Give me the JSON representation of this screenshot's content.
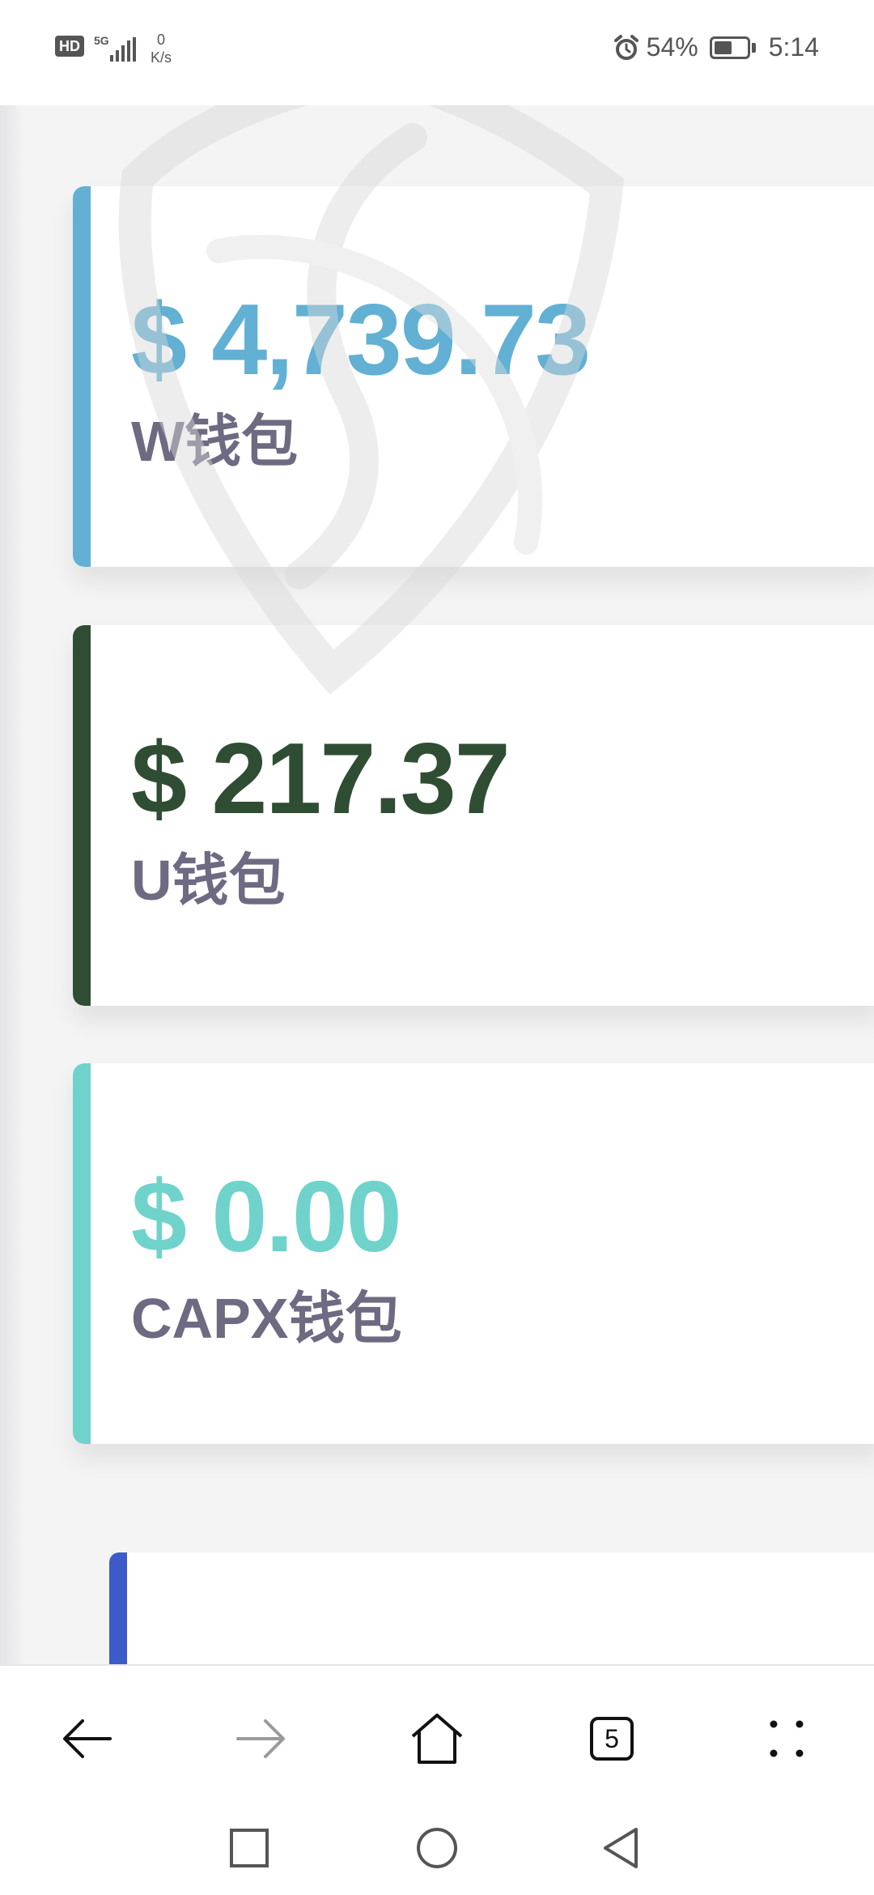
{
  "status_bar": {
    "hd": "HD",
    "network": "5G",
    "net_speed_value": "0",
    "net_speed_unit": "K/s",
    "battery_percent": "54%",
    "battery_level": 0.54,
    "time": "5:14"
  },
  "wallets": [
    {
      "amount": "$ 4,739.73",
      "label": "W钱包",
      "color": "#62b0d4"
    },
    {
      "amount": "$ 217.37",
      "label": "U钱包",
      "color": "#2f4d33"
    },
    {
      "amount": "$ 0.00",
      "label": "CAPX钱包",
      "color": "#6fd3cb"
    }
  ],
  "partial_card": {
    "color": "#3d5bc8"
  },
  "browser_bar": {
    "tab_count": "5"
  },
  "colors": {
    "label_text": "#6e6a82",
    "icon": "#111111",
    "icon_disabled": "#9a9a9a"
  }
}
